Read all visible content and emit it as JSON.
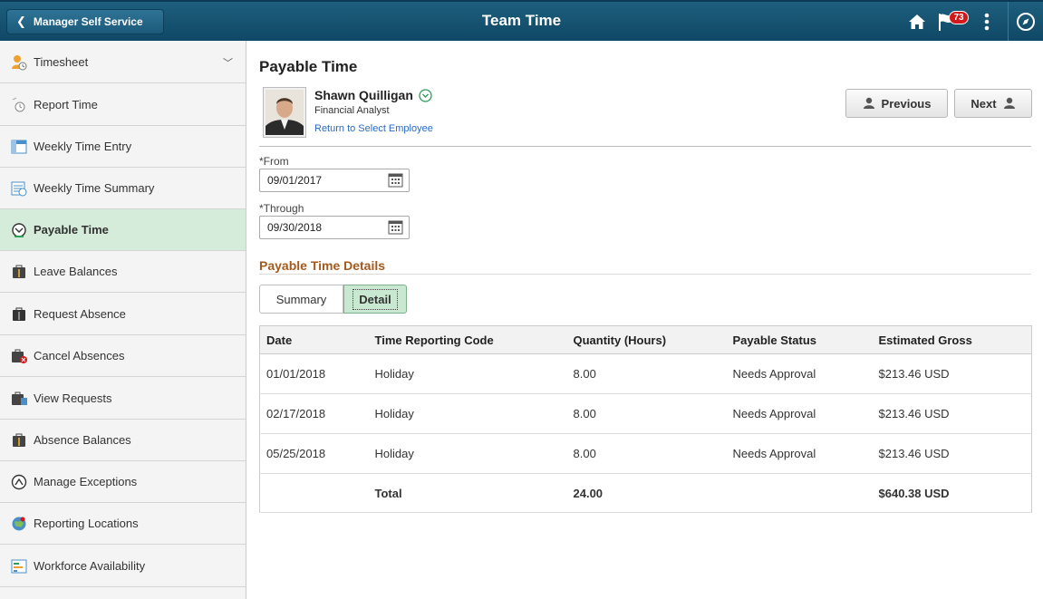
{
  "header": {
    "back_label": "Manager Self Service",
    "title": "Team Time",
    "notification_count": "73"
  },
  "sidebar": {
    "items": [
      {
        "label": "Timesheet",
        "icon": "timesheet-icon",
        "active": false,
        "collapsible": true
      },
      {
        "label": "Report Time",
        "icon": "report-time-icon",
        "active": false
      },
      {
        "label": "Weekly Time Entry",
        "icon": "weekly-entry-icon",
        "active": false
      },
      {
        "label": "Weekly Time Summary",
        "icon": "weekly-summary-icon",
        "active": false
      },
      {
        "label": "Payable Time",
        "icon": "payable-time-icon",
        "active": true
      },
      {
        "label": "Leave Balances",
        "icon": "leave-balances-icon",
        "active": false
      },
      {
        "label": "Request Absence",
        "icon": "request-absence-icon",
        "active": false
      },
      {
        "label": "Cancel Absences",
        "icon": "cancel-absences-icon",
        "active": false
      },
      {
        "label": "View Requests",
        "icon": "view-requests-icon",
        "active": false
      },
      {
        "label": "Absence Balances",
        "icon": "absence-balances-icon",
        "active": false
      },
      {
        "label": "Manage Exceptions",
        "icon": "manage-exceptions-icon",
        "active": false
      },
      {
        "label": "Reporting Locations",
        "icon": "reporting-locations-icon",
        "active": false
      },
      {
        "label": "Workforce Availability",
        "icon": "workforce-availability-icon",
        "active": false
      }
    ]
  },
  "main": {
    "title": "Payable Time",
    "employee": {
      "name": "Shawn Quilligan",
      "job_title": "Financial Analyst",
      "return_link": "Return to Select Employee"
    },
    "previous_label": "Previous",
    "next_label": "Next",
    "from": {
      "label": "*From",
      "value": "09/01/2017"
    },
    "through": {
      "label": "*Through",
      "value": "09/30/2018"
    },
    "section_title": "Payable Time Details",
    "tabs": [
      {
        "label": "Summary",
        "selected": false
      },
      {
        "label": "Detail",
        "selected": true
      }
    ],
    "table": {
      "columns": [
        "Date",
        "Time Reporting Code",
        "Quantity (Hours)",
        "Payable Status",
        "Estimated Gross"
      ],
      "rows": [
        [
          "01/01/2018",
          "Holiday",
          "8.00",
          "Needs Approval",
          "$213.46 USD"
        ],
        [
          "02/17/2018",
          "Holiday",
          "8.00",
          "Needs Approval",
          "$213.46 USD"
        ],
        [
          "05/25/2018",
          "Holiday",
          "8.00",
          "Needs Approval",
          "$213.46 USD"
        ]
      ],
      "total": [
        "",
        "Total",
        "24.00",
        "",
        "$640.38 USD"
      ]
    }
  },
  "colors": {
    "header_bg": "#0f4866",
    "active_item_bg": "#d4ecd9",
    "section_title": "#a35a1d",
    "link": "#2a6ac2",
    "badge": "#d4181a"
  }
}
